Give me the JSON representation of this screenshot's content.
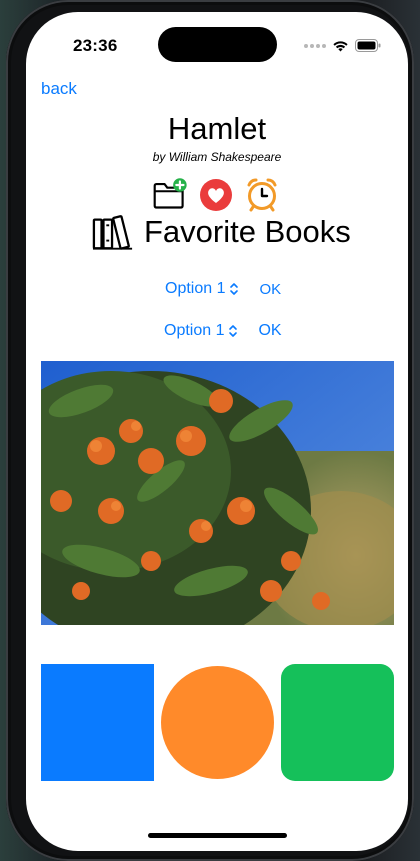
{
  "status_bar": {
    "time": "23:36",
    "icons": [
      "cellular-signal-icon",
      "wifi-icon",
      "battery-icon"
    ]
  },
  "nav": {
    "back_label": "back"
  },
  "book": {
    "title": "Hamlet",
    "author": "by William Shakespeare"
  },
  "icons": [
    "folder-add-icon",
    "heart-icon",
    "alarm-clock-icon",
    "books-icon"
  ],
  "favorites": {
    "label": "Favorite Books"
  },
  "pickers": [
    {
      "selected": "Option 1",
      "ok_label": "OK"
    },
    {
      "selected": "Option 1",
      "ok_label": "OK"
    }
  ],
  "photo": {
    "subject": "orange-blossom-photo"
  },
  "colors": {
    "accent": "#0a7bff",
    "blue_square": "#0a7bff",
    "orange_circle": "#ff8a2a",
    "green_rounded": "#15c05a",
    "heart_red": "#ea3c3c",
    "alarm_orange": "#f29a28",
    "folder_plus_green": "#26b24a"
  }
}
